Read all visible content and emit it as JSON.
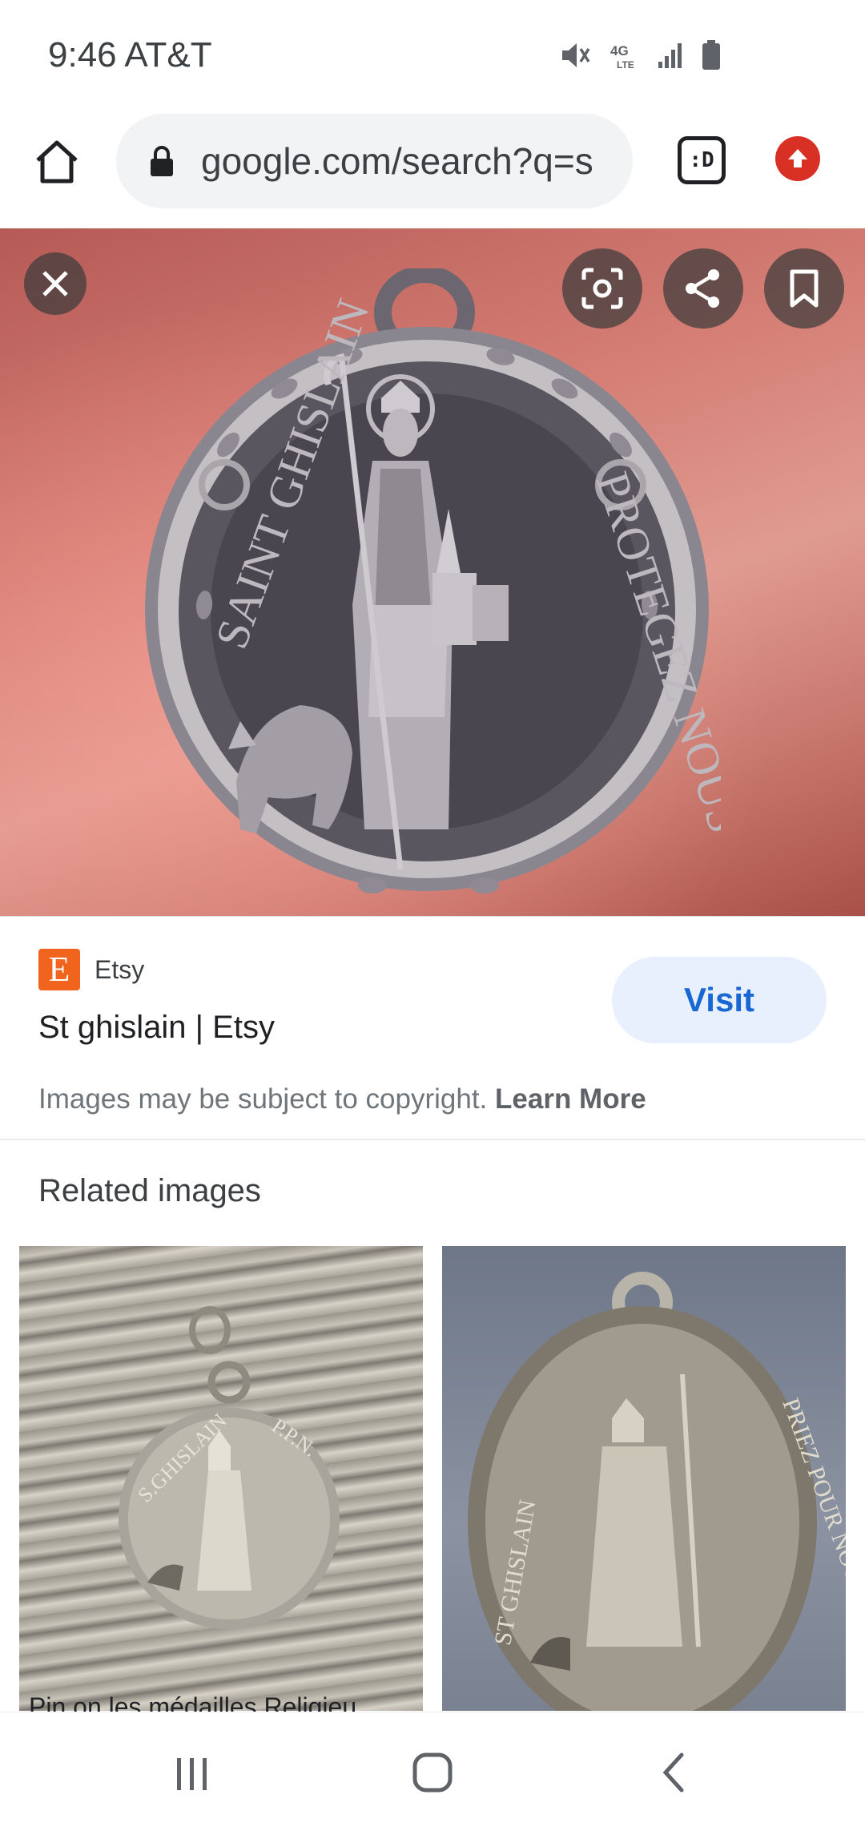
{
  "status_bar": {
    "time_carrier": "9:46 AT&T",
    "icons": [
      "mute-icon",
      "4g-lte-icon",
      "signal-icon",
      "battery-icon"
    ]
  },
  "browser": {
    "url": "google.com/search?q=s",
    "tab_switcher_label": ":D",
    "accent_update_color": "#d93025"
  },
  "image_viewer": {
    "controls": [
      "close-icon",
      "lens-icon",
      "share-icon",
      "bookmark-icon"
    ]
  },
  "source": {
    "favicon_letter": "E",
    "site_name": "Etsy",
    "title": "St ghislain | Etsy",
    "visit_label": "Visit",
    "copyright_text": "Images may be subject to copyright.",
    "learn_more_label": "Learn More"
  },
  "related": {
    "heading": "Related images",
    "items": [
      {
        "caption": "Pin on les médailles Religieu"
      },
      {
        "caption": ""
      }
    ]
  },
  "nav_bar": {
    "buttons": [
      "recent-apps-icon",
      "home-icon",
      "back-icon"
    ]
  }
}
